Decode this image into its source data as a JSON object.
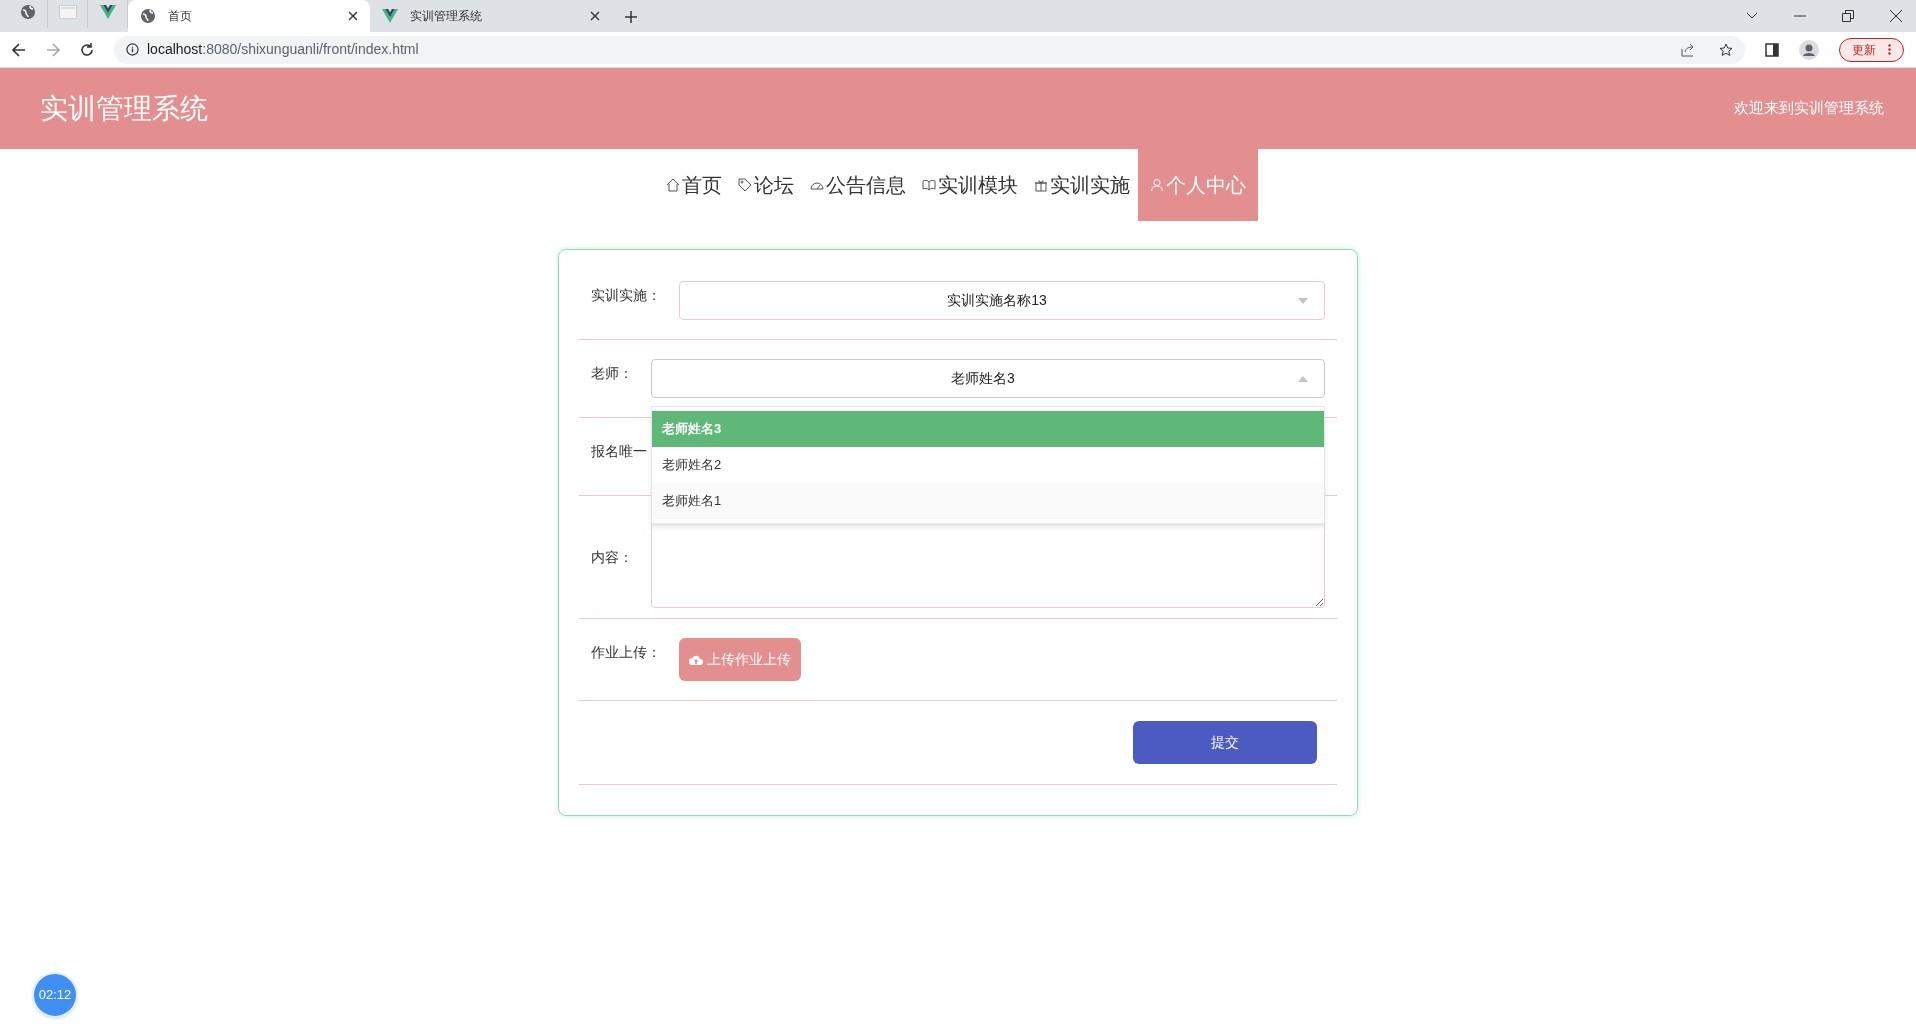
{
  "browser": {
    "pinned_tabs": [
      {
        "kind": "globe"
      },
      {
        "kind": "sheet"
      },
      {
        "kind": "vue"
      }
    ],
    "tabs": [
      {
        "title": "首页",
        "kind": "globe",
        "selected": true
      },
      {
        "title": "实训管理系统",
        "kind": "vue",
        "selected": false
      }
    ],
    "url_host": "localhost",
    "url_rest": ":8080/shixunguanli/front/index.html",
    "update_label": "更新"
  },
  "header": {
    "title": "实训管理系统",
    "welcome": "欢迎来到实训管理系统"
  },
  "nav": [
    {
      "label": "首页",
      "kind": "home",
      "selected": false
    },
    {
      "label": "论坛",
      "kind": "tag",
      "selected": false
    },
    {
      "label": "公告信息",
      "kind": "gauge",
      "selected": false
    },
    {
      "label": "实训模块",
      "kind": "book",
      "selected": false
    },
    {
      "label": "实训实施",
      "kind": "gift",
      "selected": false
    },
    {
      "label": "个人中心",
      "kind": "user",
      "selected": true
    }
  ],
  "form": {
    "fields": [
      {
        "label": "实训实施：",
        "kind": "select",
        "value": "实训实施名称13",
        "expanded": false
      },
      {
        "label": "老师：",
        "kind": "select",
        "value": "老师姓名3",
        "expanded": true,
        "options": [
          {
            "label": "老师姓名3",
            "selected": true
          },
          {
            "label": "老师姓名2",
            "selected": false
          },
          {
            "label": "老师姓名1",
            "selected": false
          }
        ]
      },
      {
        "label": "报名唯一",
        "kind": "hidden"
      },
      {
        "label": "内容：",
        "kind": "textarea"
      },
      {
        "label": "作业上传：",
        "kind": "upload",
        "button": "上传作业上传"
      }
    ],
    "submit": "提交"
  },
  "timer": "02:12"
}
